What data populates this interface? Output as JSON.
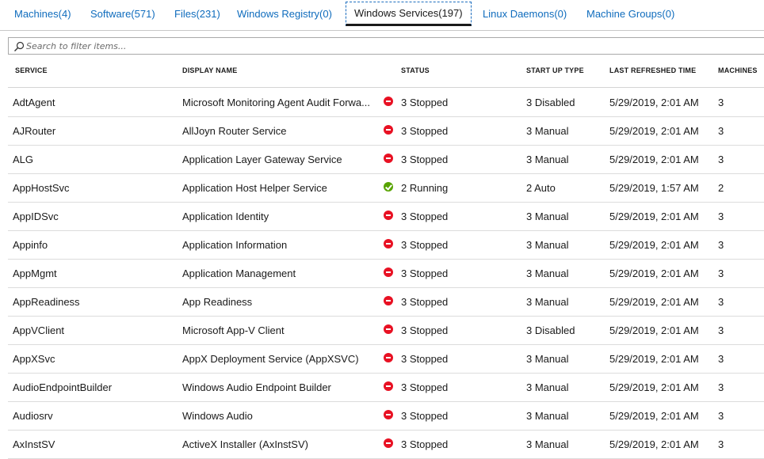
{
  "tabs": [
    {
      "label": "Machines(4)"
    },
    {
      "label": "Software(571)"
    },
    {
      "label": "Files(231)"
    },
    {
      "label": "Windows Registry(0)"
    },
    {
      "label": "Windows Services(197)"
    },
    {
      "label": "Linux Daemons(0)"
    },
    {
      "label": "Machine Groups(0)"
    }
  ],
  "search": {
    "placeholder": "Search to filter items..."
  },
  "columns": {
    "service": "SERVICE",
    "display_name": "DISPLAY NAME",
    "status": "STATUS",
    "startup_type": "START UP TYPE",
    "last_refreshed": "LAST REFRESHED TIME",
    "machines": "MACHINES"
  },
  "rows": [
    {
      "service": "AdtAgent",
      "display": "Microsoft Monitoring Agent Audit Forwa...",
      "state": "stopped",
      "status": "3 Stopped",
      "startup": "3 Disabled",
      "time": "5/29/2019, 2:01 AM",
      "machines": "3"
    },
    {
      "service": "AJRouter",
      "display": "AllJoyn Router Service",
      "state": "stopped",
      "status": "3 Stopped",
      "startup": "3 Manual",
      "time": "5/29/2019, 2:01 AM",
      "machines": "3"
    },
    {
      "service": "ALG",
      "display": "Application Layer Gateway Service",
      "state": "stopped",
      "status": "3 Stopped",
      "startup": "3 Manual",
      "time": "5/29/2019, 2:01 AM",
      "machines": "3"
    },
    {
      "service": "AppHostSvc",
      "display": "Application Host Helper Service",
      "state": "running",
      "status": "2 Running",
      "startup": "2 Auto",
      "time": "5/29/2019, 1:57 AM",
      "machines": "2"
    },
    {
      "service": "AppIDSvc",
      "display": "Application Identity",
      "state": "stopped",
      "status": "3 Stopped",
      "startup": "3 Manual",
      "time": "5/29/2019, 2:01 AM",
      "machines": "3"
    },
    {
      "service": "Appinfo",
      "display": "Application Information",
      "state": "stopped",
      "status": "3 Stopped",
      "startup": "3 Manual",
      "time": "5/29/2019, 2:01 AM",
      "machines": "3"
    },
    {
      "service": "AppMgmt",
      "display": "Application Management",
      "state": "stopped",
      "status": "3 Stopped",
      "startup": "3 Manual",
      "time": "5/29/2019, 2:01 AM",
      "machines": "3"
    },
    {
      "service": "AppReadiness",
      "display": "App Readiness",
      "state": "stopped",
      "status": "3 Stopped",
      "startup": "3 Manual",
      "time": "5/29/2019, 2:01 AM",
      "machines": "3"
    },
    {
      "service": "AppVClient",
      "display": "Microsoft App-V Client",
      "state": "stopped",
      "status": "3 Stopped",
      "startup": "3 Disabled",
      "time": "5/29/2019, 2:01 AM",
      "machines": "3"
    },
    {
      "service": "AppXSvc",
      "display": "AppX Deployment Service (AppXSVC)",
      "state": "stopped",
      "status": "3 Stopped",
      "startup": "3 Manual",
      "time": "5/29/2019, 2:01 AM",
      "machines": "3"
    },
    {
      "service": "AudioEndpointBuilder",
      "display": "Windows Audio Endpoint Builder",
      "state": "stopped",
      "status": "3 Stopped",
      "startup": "3 Manual",
      "time": "5/29/2019, 2:01 AM",
      "machines": "3"
    },
    {
      "service": "Audiosrv",
      "display": "Windows Audio",
      "state": "stopped",
      "status": "3 Stopped",
      "startup": "3 Manual",
      "time": "5/29/2019, 2:01 AM",
      "machines": "3"
    },
    {
      "service": "AxInstSV",
      "display": "ActiveX Installer (AxInstSV)",
      "state": "stopped",
      "status": "3 Stopped",
      "startup": "3 Manual",
      "time": "5/29/2019, 2:01 AM",
      "machines": "3"
    }
  ],
  "colors": {
    "link": "#0f6cbd",
    "stopped": "#e81123",
    "running": "#57a300"
  }
}
